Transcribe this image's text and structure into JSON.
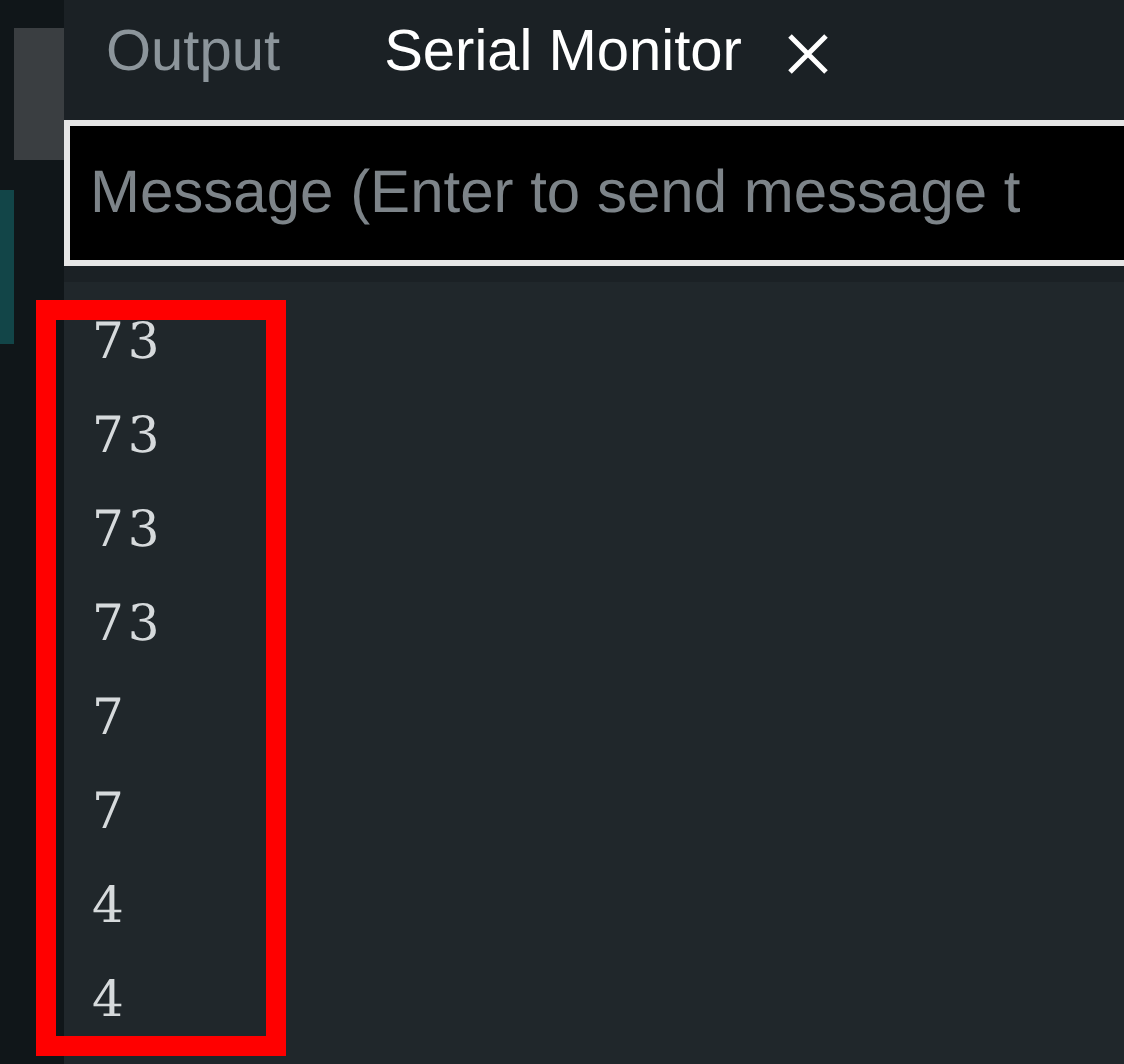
{
  "tabs": [
    {
      "label": "Output",
      "selected": false,
      "closable": false
    },
    {
      "label": "Serial Monitor",
      "selected": true,
      "closable": true
    }
  ],
  "message_input": {
    "placeholder": "Message (Enter to send message t"
  },
  "serial_lines": [
    "73",
    "73",
    "73",
    "73",
    "7",
    "7",
    "4",
    "4"
  ]
}
